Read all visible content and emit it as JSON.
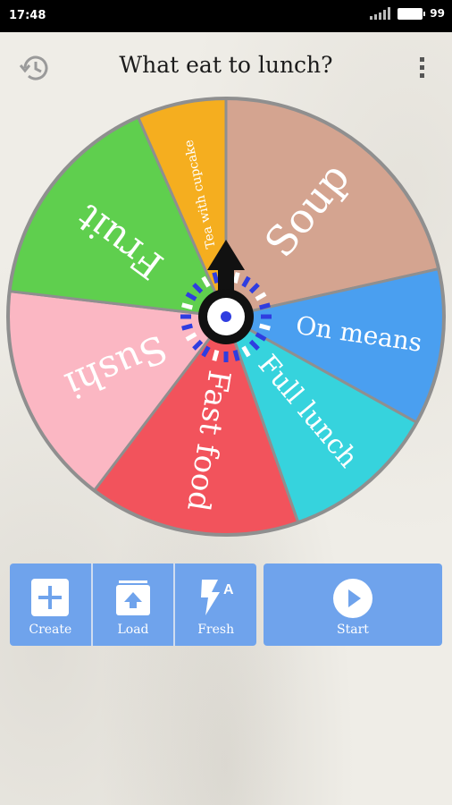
{
  "status": {
    "time": "17:48",
    "battery": "99"
  },
  "header": {
    "title": "What eat to lunch?"
  },
  "icons": {
    "history": "history-icon",
    "menu": "more-vert-icon"
  },
  "wheel": {
    "segments": [
      {
        "label": "Soup",
        "color": "#d4a490",
        "size": 52
      },
      {
        "label": "On means",
        "color": "#4a9ff0",
        "size": 28
      },
      {
        "label": "Full lunch",
        "color": "#36d3dd",
        "size": 28
      },
      {
        "label": "Fast food",
        "color": "#f2535c",
        "size": 38
      },
      {
        "label": "Sushi",
        "color": "#fbb7c3",
        "size": 40
      },
      {
        "label": "Fruit",
        "color": "#5fcf4e",
        "size": 40
      },
      {
        "label": "Tea with cupcake",
        "color": "#f5ae1f",
        "size": 16
      }
    ],
    "border_color": "#8f8f8f",
    "pointer_color": "#111111",
    "hub_dot_color": "#2f3de0"
  },
  "toolbar": {
    "create_label": "Create",
    "load_label": "Load",
    "fresh_label": "Fresh",
    "start_label": "Start"
  },
  "colors": {
    "button_bg": "#6fa3ec",
    "text": "#1b1b1b"
  }
}
